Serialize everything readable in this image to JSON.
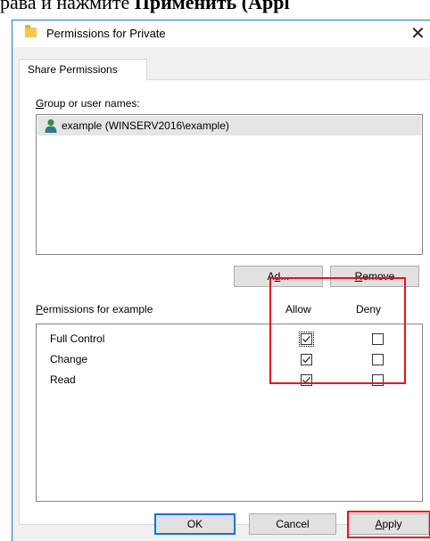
{
  "background_text": {
    "before": "рава и нажмите ",
    "bold": "Применить (Appl"
  },
  "dialog": {
    "title": "Permissions for Private",
    "close_glyph": "✕",
    "tab_label": "Share Permissions"
  },
  "groups": {
    "label_u": "G",
    "label_rest": "roup or user names:",
    "users": [
      {
        "name": "example (WINSERV2016\\example)"
      }
    ]
  },
  "buttons": {
    "add_u": "d",
    "add_pre": "A",
    "add_post": "...",
    "remove_u": "R",
    "remove_rest": "emove",
    "ok": "OK",
    "cancel": "Cancel",
    "apply_u": "A",
    "apply_rest": "pply"
  },
  "permissions": {
    "label_u": "P",
    "label_rest": "ermissions for example",
    "allow_header": "Allow",
    "deny_header": "Deny",
    "rows": [
      {
        "name": "Full Control",
        "allow": true,
        "deny": false
      },
      {
        "name": "Change",
        "allow": true,
        "deny": false
      },
      {
        "name": "Read",
        "allow": true,
        "deny": false
      }
    ]
  },
  "colors": {
    "highlight_red": "#e81123",
    "accent_blue": "#0078d7"
  }
}
